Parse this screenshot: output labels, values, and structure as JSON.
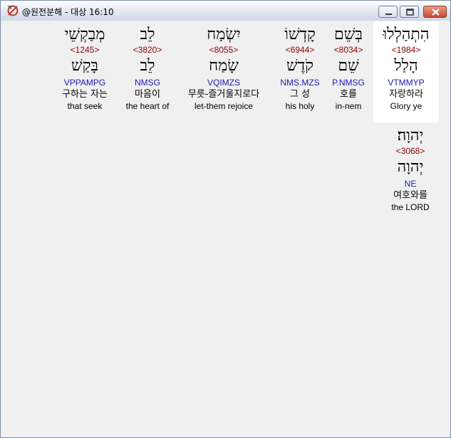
{
  "window": {
    "title": "@원전분해 - 대상 16:10",
    "buttons": {
      "minimize": "minimize-icon",
      "maximize": "maximize-icon",
      "close": "close-icon"
    }
  },
  "words": [
    {
      "hebrew": "מְבַקְשֵׁי",
      "strong": "<1245>",
      "root": "בָּקַשׁ",
      "morph": "VPPAMPG",
      "korean": "구하는 자는",
      "english": "that seek"
    },
    {
      "hebrew": "לֵב",
      "strong": "<3820>",
      "root": "לֵב",
      "morph": "NMSG",
      "korean": "마음이",
      "english": "the heart of"
    },
    {
      "hebrew": "יִשְׂמַח",
      "strong": "<8055>",
      "root": "שָׂמַח",
      "morph": "VQIMZS",
      "korean": "무릇-즐거울지로다",
      "english": "let-them rejoice"
    },
    {
      "hebrew": "קָדְשׁוֹ",
      "strong": "<6944>",
      "root": "קֹדֶשׁ",
      "morph": "NMS.MZS",
      "korean": "그 성",
      "english": "his holy"
    },
    {
      "hebrew": "בְּשֵׁם",
      "strong": "<8034>",
      "root": "שֵׁם",
      "morph": "P.NMSG",
      "korean": "호를",
      "english": "in-nem"
    },
    {
      "hebrew": "הִתְהַלְלוּ",
      "strong": "<1984>",
      "root": "הָלַל",
      "morph": "VTMMYP",
      "korean": "자랑하라",
      "english": "Glory ye"
    },
    {
      "hebrew": "יְהוָה׃",
      "strong": "<3068>",
      "root": "יְהוָה",
      "morph": "NE",
      "korean": "여호와를",
      "english": "the LORD"
    }
  ],
  "colors": {
    "strong": "#8b0000",
    "morph": "#1a1ab0",
    "selected_bg": "#ffffff"
  }
}
